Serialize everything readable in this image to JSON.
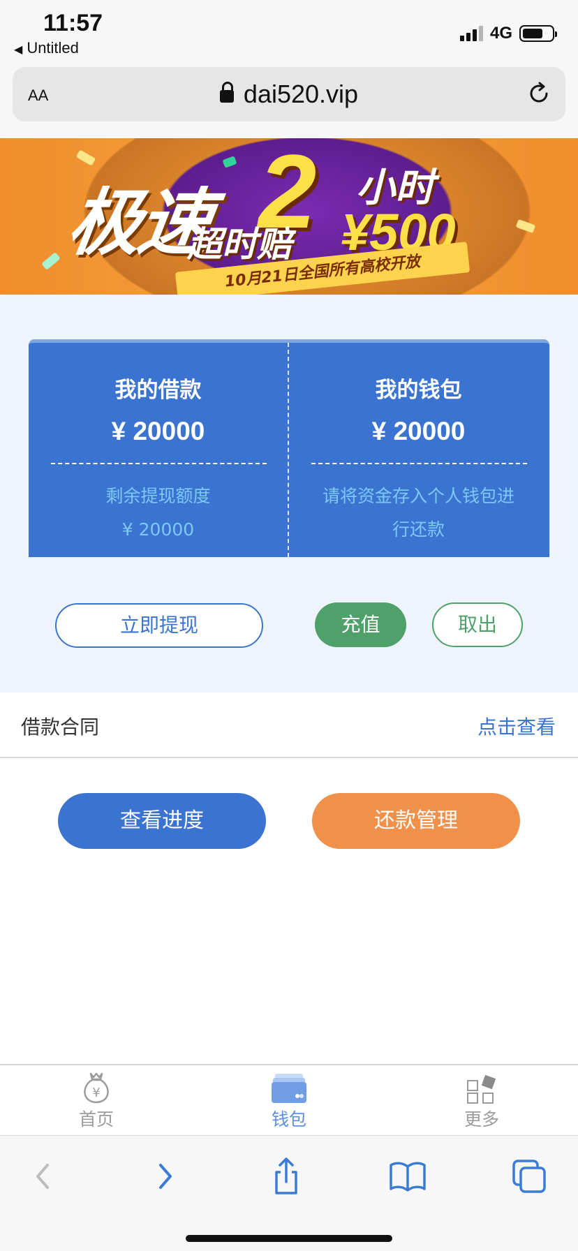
{
  "status_bar": {
    "time": "11:57",
    "back_label": "Untitled",
    "network": "4G"
  },
  "address_bar": {
    "text_size_label": "AA",
    "url": "dai520.vip"
  },
  "banner": {
    "headline": "极速",
    "number": "2",
    "hours": "小时",
    "subline": "超时赔",
    "amount": "¥500",
    "ribbon_text": "10月21日全国所有高校开放"
  },
  "card": {
    "loan": {
      "title": "我的借款",
      "amount": "¥ 20000",
      "note_line1": "剩余提现额度",
      "note_line2": "¥ 20000"
    },
    "wallet": {
      "title": "我的钱包",
      "amount": "¥ 20000",
      "note_line1": "请将资金存入个人钱包进",
      "note_line2": "行还款"
    }
  },
  "actions": {
    "withdraw": "立即提现",
    "recharge": "充值",
    "takeout": "取出"
  },
  "contract": {
    "label": "借款合同",
    "link": "点击查看"
  },
  "bottom_actions": {
    "progress": "查看进度",
    "repay": "还款管理"
  },
  "tabs": [
    {
      "label": "首页",
      "icon": "money-bag-icon"
    },
    {
      "label": "钱包",
      "icon": "wallet-icon"
    },
    {
      "label": "更多",
      "icon": "grid-icon"
    }
  ],
  "colors": {
    "primary_blue": "#3a74d0",
    "green": "#4fa069",
    "orange": "#f0914b",
    "note_cyan": "#7ec8f5",
    "page_bg": "#eef4fb"
  }
}
